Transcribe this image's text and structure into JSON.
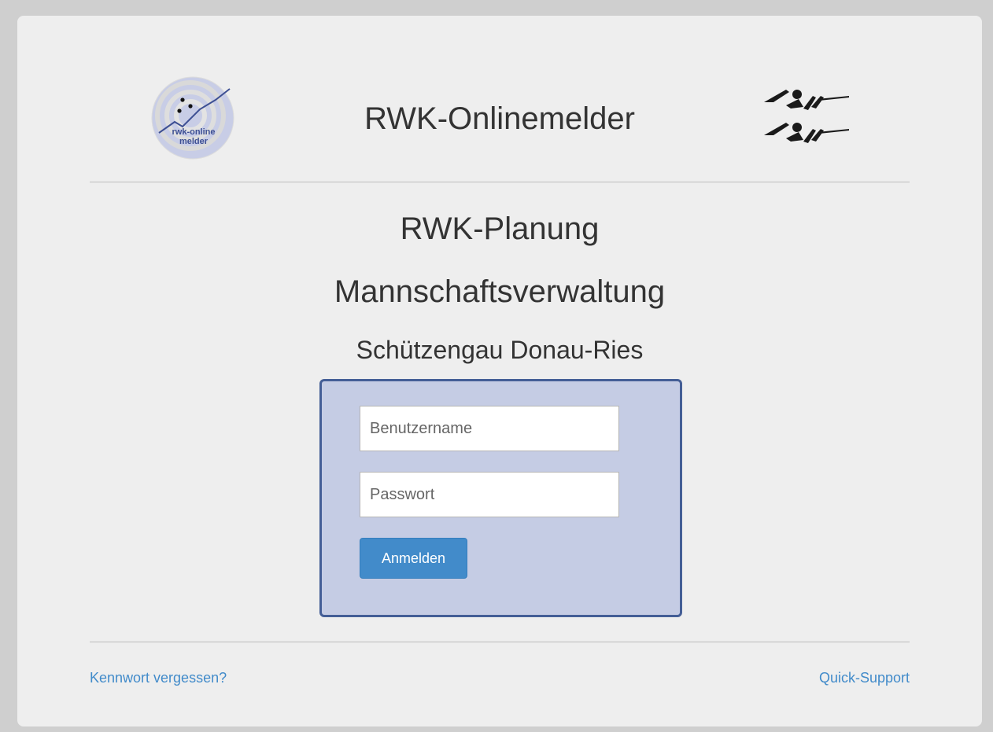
{
  "header": {
    "app_title": "RWK-Onlinemelder",
    "logo_left_text_line1": "rwk-online",
    "logo_left_text_line2": "melder"
  },
  "headings": {
    "planning": "RWK-Planung",
    "team_admin": "Mannschaftsverwaltung",
    "district": "Schützengau Donau-Ries"
  },
  "login": {
    "username_placeholder": "Benutzername",
    "password_placeholder": "Passwort",
    "submit_label": "Anmelden"
  },
  "footer": {
    "forgot_password": "Kennwort vergessen?",
    "quick_support": "Quick-Support"
  },
  "colors": {
    "login_box_bg": "#c5cce4",
    "login_box_border": "#445e96",
    "button_primary": "#428bca",
    "link": "#428bca"
  }
}
